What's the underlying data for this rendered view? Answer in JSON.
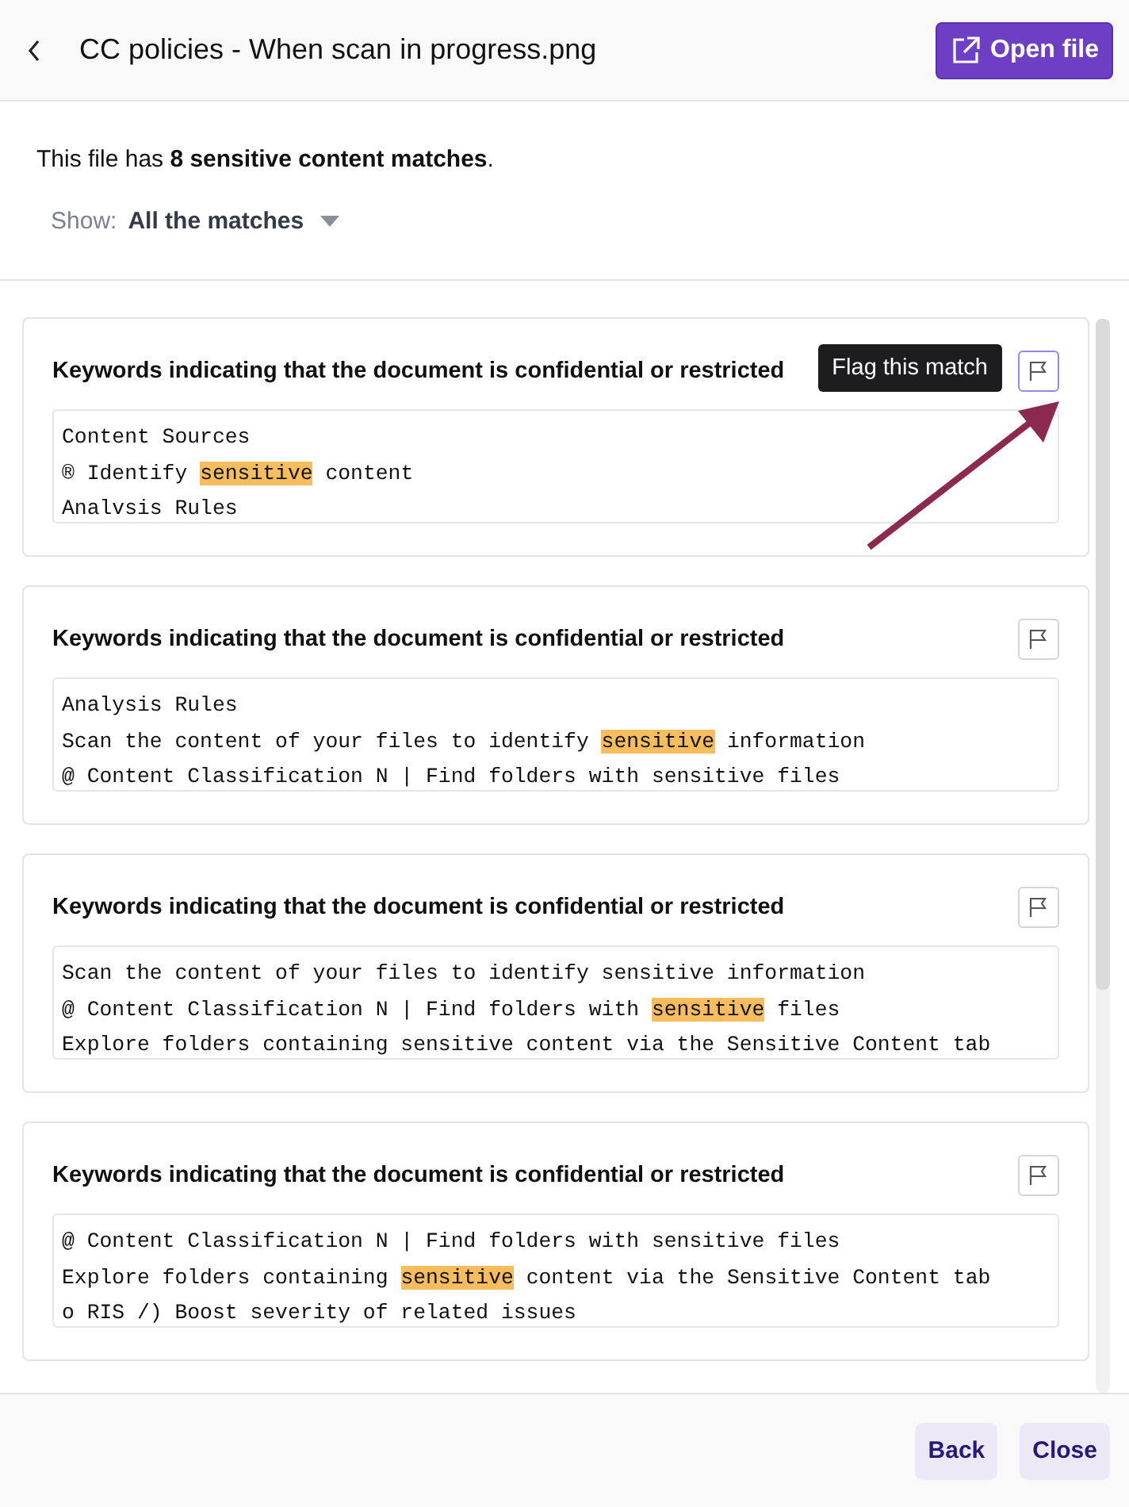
{
  "header": {
    "title": "CC policies - When scan in progress.png",
    "open_button": "Open file"
  },
  "summary": "This file has **8 sensitive content matches**.",
  "filter": {
    "label": "Show:",
    "value": "All the matches"
  },
  "matches": [
    {
      "title": "Keywords indicating that the document is confidential or restricted",
      "flag_hovered": true,
      "tooltip": "Flag this match",
      "lines": [
        [
          {
            "text": "Content Sources",
            "highlighted": false
          }
        ],
        [
          {
            "text": "® Identify ",
            "highlighted": false
          },
          {
            "text": "sensitive",
            "highlighted": true
          },
          {
            "text": " content",
            "highlighted": false
          }
        ],
        [
          {
            "text": "Analvsis Rules",
            "highlighted": false
          }
        ]
      ]
    },
    {
      "title": "Keywords indicating that the document is confidential or restricted",
      "flag_hovered": false,
      "lines": [
        [
          {
            "text": "Analysis Rules",
            "highlighted": false
          }
        ],
        [
          {
            "text": "Scan the content of your files to identify ",
            "highlighted": false
          },
          {
            "text": "sensitive",
            "highlighted": true
          },
          {
            "text": " information",
            "highlighted": false
          }
        ],
        [
          {
            "text": "@ Content Classification N | Find folders with sensitive files",
            "highlighted": false
          }
        ]
      ]
    },
    {
      "title": "Keywords indicating that the document is confidential or restricted",
      "flag_hovered": false,
      "lines": [
        [
          {
            "text": "Scan the content of your files to identify sensitive information",
            "highlighted": false
          }
        ],
        [
          {
            "text": "@ Content Classification N | Find folders with ",
            "highlighted": false
          },
          {
            "text": "sensitive",
            "highlighted": true
          },
          {
            "text": " files",
            "highlighted": false
          }
        ],
        [
          {
            "text": "Explore folders containing sensitive content via the Sensitive Content tab",
            "highlighted": false
          }
        ]
      ]
    },
    {
      "title": "Keywords indicating that the document is confidential or restricted",
      "flag_hovered": false,
      "lines": [
        [
          {
            "text": "@ Content Classification N | Find folders with sensitive files",
            "highlighted": false
          }
        ],
        [
          {
            "text": "Explore folders containing ",
            "highlighted": false
          },
          {
            "text": "sensitive",
            "highlighted": true
          },
          {
            "text": " content via the Sensitive Content tab",
            "highlighted": false
          }
        ],
        [
          {
            "text": "o RIS /) Boost severity of related issues",
            "highlighted": false
          }
        ]
      ]
    }
  ],
  "footer": {
    "buttons": [
      "Back",
      "Close"
    ]
  }
}
